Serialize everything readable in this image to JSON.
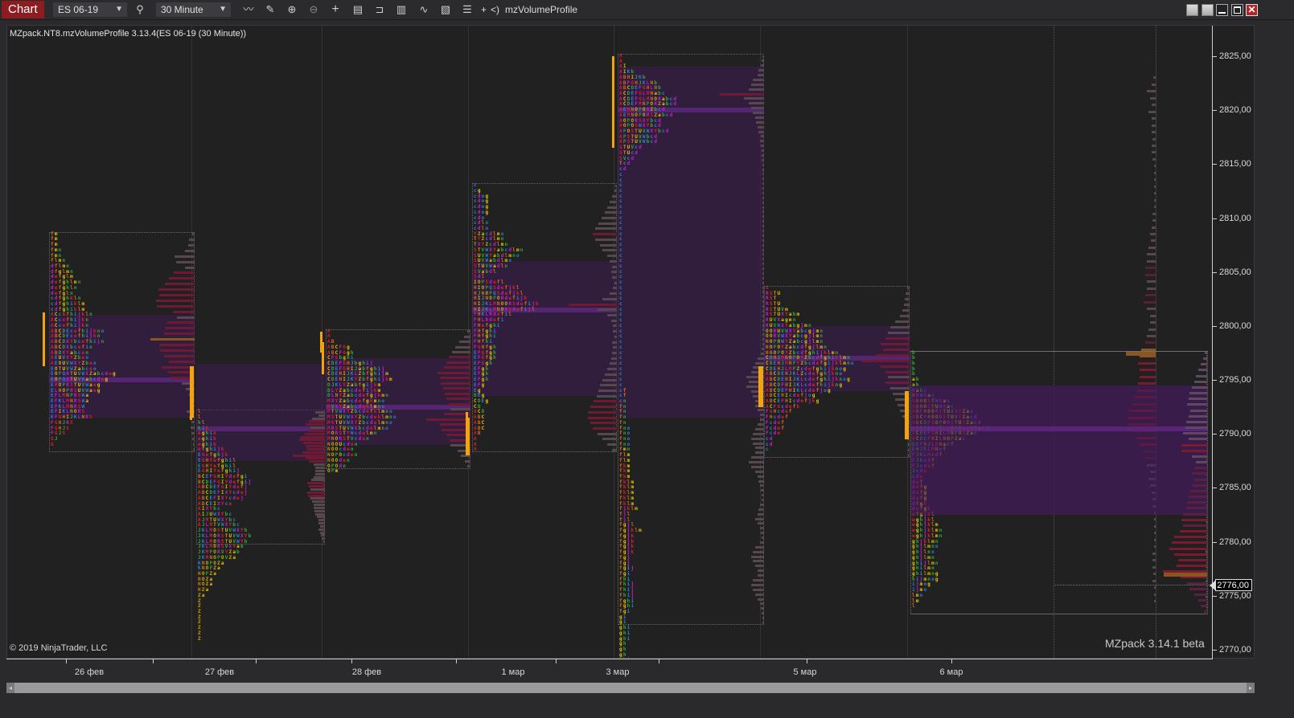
{
  "window": {
    "tab_label": "Chart",
    "instrument": "ES 06-19",
    "timeframe": "30 Minute",
    "indicator_button": "mzVolumeProfile",
    "plus_label": "+",
    "nav_label": "<)",
    "toolbar_icons": [
      "search-icon",
      "line-chart-icon",
      "pencil-icon",
      "zoom-in-icon",
      "zoom-out-icon",
      "crosshair-icon",
      "data-box-icon",
      "bar-spacing-icon",
      "chart-style-icon",
      "indicators-icon",
      "strategies-icon",
      "properties-list-icon"
    ],
    "window_buttons": [
      "restore-icon",
      "tile-icon",
      "minimize-icon",
      "maximize-icon",
      "close-icon"
    ]
  },
  "chart": {
    "indicator_label": "MZpack.NT8.mzVolumeProfile 3.13.4(ES 06-19 (30 Minute))",
    "copyright": "© 2019 NinjaTrader, LLC",
    "watermark": "MZpack 3.14.1 beta",
    "current_price": "2776,00",
    "price_range": [
      2770,
      2825
    ],
    "price_ticks": [
      "2825,00",
      "2820,00",
      "2815,00",
      "2810,00",
      "2805,00",
      "2800,00",
      "2795,00",
      "2790,00",
      "2785,00",
      "2780,00",
      "2775,00",
      "2770,00"
    ],
    "price_tick_values": [
      2825,
      2820,
      2815,
      2810,
      2805,
      2800,
      2795,
      2790,
      2785,
      2780,
      2775,
      2770
    ],
    "date_labels": [
      "26 фев",
      "27 фев",
      "28 фев",
      "1 мар",
      "3 мар",
      "5 мар",
      "6 мар"
    ],
    "colors": {
      "background": "#212121",
      "value_area": "#3b1e4f",
      "poc": "#5e2a7e",
      "volume_high": "#7a1a33",
      "volume_low": "#5a4a50",
      "volume_poc": "#8a5520",
      "initial_balance": "#f5a30c"
    }
  },
  "profiles": [
    {
      "date": "26 фев",
      "high": 2808.5,
      "low": 2788.5,
      "va_high": 2801,
      "va_low": 2791.5,
      "poc": 2795,
      "ib_high": 2801.25,
      "ib_low": 2796.25,
      "ib2_high": 2796.25,
      "ib2_low": 2791.5,
      "vol_poc": 2799,
      "tpo_rows": [
        "fm",
        "fm",
        "fm",
        "fmn",
        "fmn",
        "flmn",
        "dflmn",
        "dfglmn",
        "defglm",
        "defghlmn",
        "defghln",
        "defgln",
        "cdfghkln",
        "cdfghiklm",
        "cdfghiklm",
        "ACcefhijkln",
        "ACcefhijkn",
        "ACcefhijkn",
        "ABCDEcefhijkno",
        "ABCDEcefhijkn",
        "ABCDXYbcefhijn",
        "ABCDXbcefin",
        "ABDXYabcen",
        "AEUVXYZbeo",
        "AEOUVWXYZbeo",
        "EOTUVWZabceo",
        "EOPQRTUVWXZabcdeg",
        "EOPQRTUVWabcdeg",
        "EMOPRSTUVWaeg",
        "ELNOPRSUVWaeg",
        "EFLMNPRSWa",
        "EFKLMNRSWa",
        "EFKLMNRSW",
        "EFIKLNORS",
        "EFGHIJKLNRS",
        "FGHJRS",
        "FGHJS",
        "FGJS",
        "GJ",
        "G"
      ],
      "volume": [
        0.05,
        0.12,
        0.15,
        0.22,
        0.45,
        0.42,
        0.22,
        0.48,
        0.58,
        0.68,
        0.82,
        0.8,
        0.88,
        0.86,
        0.5,
        0.4,
        0.62,
        0.68,
        0.7,
        1.0,
        0.8,
        0.78,
        0.7,
        0.58,
        0.74,
        0.6,
        0.54,
        0.3,
        0.2,
        0.12,
        0.1,
        0.1,
        0.18,
        0.12,
        0.08,
        0.1,
        0.08,
        0.06,
        0.04,
        0.02
      ]
    },
    {
      "date": "27 фев",
      "high": 2792,
      "low": 2780,
      "va_high": 2796.5,
      "va_low": 2787.5,
      "poc": 2790.5,
      "ib_high": 2796.25,
      "ib_low": 2791.25,
      "ib2_high": 2798.5,
      "ib2_low": 2795.5,
      "vol_poc": 2797.5,
      "tpo_rows": [
        "l",
        "l",
        "hl",
        "hik",
        "eghik",
        "eghik",
        "eghik",
        "efghijk",
        "EGefghjk",
        "EGHYefghil",
        "EGHYefghil",
        "EGHIYefghij",
        "BCEFGHIYdefgi",
        "BCDEFGIYdefgij",
        "ABCDEFGIYdefj",
        "ABCDEFIXYcdej",
        "ABCEFIXYcdej",
        "ABCEIXYce",
        "AIXYbc",
        "AIJUWXYbc",
        "AJMTUWXYbc",
        "AJLMTVWXYbc",
        "JKLMOSTUVWXYb",
        "JKLMORSTUVWXYb",
        "JKLMORSTUVWYb",
        "JKLMORSVXYab",
        "JKMPORVYZab",
        "JKMNOPOVZa",
        "KNOPOZa",
        "KNOPZa",
        "NOPZa",
        "NOZa",
        "NOZa",
        "NZa",
        "Za",
        "Z",
        "Z",
        "Z",
        "Z",
        "Z",
        "Z",
        "Z",
        "Z"
      ],
      "volume": [
        0.3,
        0.2,
        0.4,
        0.5,
        0.6,
        0.45,
        0.5,
        0.62,
        0.75,
        0.8,
        0.68,
        0.6,
        0.55,
        0.7,
        1.0,
        0.6,
        0.5,
        0.35,
        0.3,
        0.3,
        0.3,
        0.35,
        0.42,
        0.55,
        0.5,
        0.45,
        0.55,
        0.52,
        0.45,
        0.4,
        0.35,
        0.35,
        0.32,
        0.3,
        0.25,
        0.2,
        0.2,
        0.15,
        0.2,
        0.15,
        0.12,
        0.1,
        0.05
      ]
    },
    {
      "date": "28 фев",
      "high": 2799.5,
      "low": 2787,
      "va_high": 2797,
      "va_low": 2789,
      "poc": 2792.5,
      "ib_high": 2799.5,
      "ib_low": 2797.5,
      "ib2_high": 2791.5,
      "ib2_low": 2788,
      "vol_poc": 2793.5,
      "tpo_rows": [
        "A",
        "A",
        "AB",
        "ABCFGg",
        "ABCFGgh",
        "CFGbghi",
        "CDEFGHJbghij",
        "CDEFGHIJabfghij",
        "CDEHIJKLZbfghijm",
        "CDEHIJKYZbfghijkm",
        "DJKLYZabfgijkm",
        "DLYZabcdefijkm",
        "DLNYZabcdefgjkmn",
        "MXYZabcdefgkmno",
        "MVXYZabcdeklmno",
        "MTVWXYZbcdefklmno",
        "MSTUVWXYZbcdeklmno",
        "MSTUVWXYZbcdelmno",
        "MRSTUVWXbcdelmno",
        "MORSTYWcdelmn",
        "MNORSTVcden",
        "NOOUcden",
        "NOOcden",
        "NOPOcden",
        "NOOden",
        "OPOdn",
        "OPm"
      ],
      "volume": [
        0.08,
        0.15,
        0.25,
        0.35,
        0.42,
        0.5,
        0.55,
        0.6,
        0.75,
        0.7,
        0.68,
        0.62,
        0.58,
        0.55,
        0.5,
        0.45,
        0.6,
        1.0,
        0.7,
        0.65,
        0.55,
        0.48,
        0.45,
        0.3,
        0.22,
        0.12,
        0.08
      ]
    },
    {
      "date": "1 мар",
      "high": 2813,
      "low": 2788.5,
      "va_high": 2806,
      "va_low": 2793.5,
      "poc": 2801.5,
      "ib_high": 2792,
      "ib_low": 2788,
      "vol_poc": 2801.5,
      "tpo_rows": [
        "c",
        "cg",
        "cdog",
        "cdog",
        "cdog",
        "cdog",
        "cdo",
        "cdlo",
        "cdlo",
        "YZacdlmo",
        "TYZcdlmn",
        "TXYZcdlmn",
        "STVWXYabcdlmn",
        "SUVWYabdlmno",
        "SUVWabdlmo",
        "STUVWadln",
        "SVabdl",
        "Sdl",
        "IOPSdefl",
        "HIOPQSdefjkl",
        "HJNOPQSdefjkl",
        "HIJNOPORdefijk",
        "HIJKLMNOORSdefijk",
        "HIJKLMNORSdefijl",
        "FHKLRdefil",
        "FHLRdefi",
        "FHefghi",
        "FHfghi",
        "FHfghi",
        "FHfhi",
        "FGHfgh",
        "EFGfgh",
        "EFGfgh",
        "EFGgh",
        "EFgh",
        "EFgh",
        "EFgh",
        "EFg",
        "Eg",
        "DEg",
        "CDEg",
        "CD",
        "ACD",
        "ABC",
        "ABC",
        "ABC",
        "AB",
        "A",
        "A",
        "A"
      ],
      "volume": [
        0.02,
        0.05,
        0.1,
        0.15,
        0.2,
        0.25,
        0.32,
        0.38,
        0.45,
        0.5,
        0.45,
        0.35,
        0.3,
        0.2,
        0.15,
        0.1,
        0.12,
        0.1,
        0.05,
        0.08,
        0.15,
        0.3,
        1.0,
        0.4,
        0.2,
        0.12,
        0.08,
        0.08,
        0.05,
        0.1,
        0.08,
        0.1,
        0.12,
        0.15,
        0.2,
        0.25,
        0.3,
        0.35,
        0.38,
        0.42,
        0.48,
        0.55,
        0.6,
        0.6,
        0.55,
        0.5,
        0.4,
        0.3,
        0.2,
        0.1
      ]
    },
    {
      "date": "3 мар",
      "high": 2825,
      "low": 2772.5,
      "va_high": 2824,
      "va_low": 2791.5,
      "poc": 2820,
      "ib_high": 2825,
      "ib_low": 2816.5,
      "ib2_high": 2796.25,
      "ib2_low": 2792.5,
      "vol_poc": 2821,
      "tpo_rows": [
        "A",
        "A",
        "AI",
        "AIKb",
        "ABHIJKb",
        "ABFGHJKLNb",
        "ABCDEFGHLNb",
        "ACDEFGLMNabc",
        "ACDEFGLMNORabcd",
        "ACDEFMNPORZabcd",
        "AEMNOPORZbcd",
        "AEMNOPORSZabcd",
        "AOPORSXYbcd",
        "AOPOSWXYbcd",
        "APOSTUVWXYbcd",
        "APSTUVWbcd",
        "APSTUVWbcd",
        "STUVcd",
        "STUcd",
        "SVcd",
        "Tcd",
        "cd",
        "c",
        "c",
        "c",
        "c",
        "c",
        "c",
        "c",
        "c",
        "c",
        "c",
        "c",
        "c",
        "c",
        "c",
        "c",
        "c",
        "c",
        "c",
        "c",
        "c",
        "c",
        "c",
        "c",
        "c",
        "c",
        "c",
        "c",
        "c",
        "c",
        "c",
        "c",
        "c",
        "c",
        "c",
        "c",
        "c",
        "c",
        "c",
        "c",
        "c",
        "cf",
        "cf",
        "cn",
        "fn",
        "fn",
        "fn",
        "fn",
        "fno",
        "fno",
        "fno",
        "fno",
        "fmn",
        "flm",
        "flm",
        "fkm",
        "fkm",
        "fkm",
        "fklm",
        "fklm",
        "fklm",
        "fklm",
        "fklm",
        "fjklm",
        "fjl",
        "fjl",
        "fgjl",
        "fgjklm",
        "fgjk",
        "fgjk",
        "fgjk",
        "fgjk",
        "fgj",
        "fgj",
        "fgij",
        "fgi",
        "fhi",
        "fhij",
        "fhij",
        "fhij",
        "fghi",
        "fghi",
        "fgi",
        "gi",
        "gi",
        "ghi",
        "ghi",
        "ghi",
        "gh",
        "gh",
        "gh",
        "ghi",
        "ghi",
        "ghi",
        "ghi",
        "hi",
        "hi",
        "h"
      ],
      "volume": [
        0.02,
        0.05,
        0.08,
        0.12,
        0.15,
        0.25,
        0.3,
        0.35,
        1.0,
        0.45,
        0.35,
        0.3,
        0.25,
        0.2,
        0.18,
        0.15,
        0.12,
        0.08,
        0.1,
        0.08,
        0.06,
        0.05,
        0.05,
        0.04,
        0.04,
        0.03,
        0.03,
        0.03,
        0.03,
        0.02,
        0.02,
        0.02,
        0.02,
        0.02,
        0.02,
        0.02,
        0.02,
        0.02,
        0.02,
        0.02,
        0.02,
        0.02,
        0.02,
        0.02,
        0.02,
        0.02,
        0.02,
        0.02,
        0.02,
        0.02,
        0.02,
        0.02,
        0.02,
        0.02,
        0.02,
        0.02,
        0.02,
        0.02,
        0.02,
        0.03,
        0.03,
        0.04,
        0.05,
        0.08,
        0.15,
        0.2,
        0.25,
        0.3,
        0.4,
        0.35,
        0.4,
        0.3,
        0.25,
        0.2,
        0.2,
        0.15,
        0.1,
        0.1,
        0.15,
        0.2,
        0.25,
        0.3,
        0.25,
        0.2,
        0.2,
        0.3,
        0.35,
        0.3,
        0.2,
        0.15,
        0.12,
        0.1,
        0.08,
        0.05,
        0.05,
        0.1,
        0.12,
        0.15,
        0.2,
        0.15,
        0.1,
        0.08,
        0.05,
        0.1,
        0.2,
        0.25,
        0.3,
        0.25,
        0.2,
        0.15,
        0.15,
        0.25,
        0.3,
        0.25,
        0.2,
        0.15,
        0.1,
        0.08,
        0.05,
        0.03,
        0.02
      ]
    },
    {
      "date": "5 мар",
      "high": 2803.5,
      "low": 2788,
      "va_high": 2800,
      "va_low": 2794,
      "poc": 2797,
      "ib_high": 2796.25,
      "ib_low": 2792.5,
      "ib2_high": 2794,
      "ib2_low": 2789.5,
      "vol_poc": 2797.5,
      "tpo_rows": [
        "S",
        "RSTU",
        "RST",
        "RSTU",
        "RSTUVm",
        "RSTUXYabm",
        "RUVXagmn",
        "RUVWXYabgjmn",
        "OORUVWXYabcgjmn",
        "OORVWXYabcgjlmn",
        "NOPOWYZabcgjlmn",
        "NOPOYZabcdfgjlmn",
        "HNOPOYZbcdfghijklmn",
        "CDHJMNOPOYZbcdfghiklmn",
        "CDEHJMNPYZbcdefgijklmno",
        "CDEHJLMPZcdefghijknog",
        "ABCDEHJKLZcdefghjkno",
        "ABCDEHIJKLcdefghijknog",
        "ABCDFHIJKLcdefhijkng",
        "ABCDEFHIKLcdefjog",
        "ABCEHIcdefjog",
        "ABCEFHIcdefjkg",
        "ACFGcdefk",
        "FGHcdef",
        "FHcdef",
        "Fcdef",
        "Fcdef",
        "Fcde",
        "cd",
        "cd",
        "c"
      ],
      "volume": [
        0.05,
        0.08,
        0.1,
        0.12,
        0.15,
        0.2,
        0.3,
        0.4,
        0.45,
        0.5,
        0.6,
        0.55,
        0.7,
        1.0,
        0.6,
        0.5,
        0.45,
        0.5,
        0.4,
        0.35,
        0.3,
        0.25,
        0.2,
        0.15,
        0.1,
        0.08,
        0.06,
        0.05,
        0.04,
        0.03,
        0.02
      ]
    },
    {
      "date": "6 мар",
      "high": 2797.5,
      "low": 2773.5,
      "va_high": 2794.5,
      "va_low": 2782.5,
      "poc": 2790.5,
      "ib_high": 2794,
      "ib_low": 2789.5,
      "vol_poc": 2797.5,
      "tpo_rows": [
        "b",
        "b",
        "b",
        "b",
        "b",
        "ab",
        "ab",
        "Rabc",
        "BRWXac",
        "ABHOSTWXac",
        "ABHOSTUWXac",
        "ABFHOORSTUVXYZac",
        "ABCFHOORSTUVYZacd",
        "ABCDFGOPORSTUYZacd",
        "ABCDEFGILMOPORSUZacd",
        "ACDEFGHILMOPOSZac",
        "ACDEFHILNOPZac",
        "DEFHJLMNacf",
        "EHJKLMNcf",
        "FJKLMcdf",
        "FJKcdf",
        "FJcdef",
        "Jcde",
        "cde",
        "def",
        "defg",
        "defg",
        "defg",
        "dfgk",
        "defgk",
        "efgjkl",
        "eghjkl",
        "eghjklm",
        "eghjklmn",
        "eghjklmn",
        "ghjklmn",
        "ghjlmno",
        "ghjlno",
        "ghjlmn",
        "ghijlmn",
        "ghilmn",
        "ghilmng",
        "hijmnog",
        "ijmog",
        "ijmo",
        "lmo",
        "lm",
        "l"
      ],
      "volume": [
        0.9,
        0.75,
        0.6,
        0.5,
        0.4,
        0.35,
        0.3,
        0.25,
        0.2,
        0.18,
        0.16,
        0.15,
        0.14,
        0.13,
        0.12,
        0.1,
        0.08,
        0.05
      ]
    }
  ],
  "developing_profile": {
    "label": "6 мар",
    "high": 2823,
    "low": 2774.5,
    "vol_poc": 2797.5,
    "volume": [
      0.08,
      0.15,
      0.3,
      0.2,
      0.15,
      0.25,
      0.15,
      0.15,
      0.15,
      0.1,
      0.15,
      0.15,
      0.1,
      0.05,
      0.05,
      0.02,
      0.02,
      0.02,
      0.02,
      0.05,
      0.1,
      0.12,
      0.15,
      0.2,
      0.18,
      0.25,
      0.3,
      0.3,
      0.35,
      0.35,
      0.3,
      0.3,
      0.35,
      0.42,
      0.3,
      0.2,
      0.2,
      0.25,
      0.3,
      0.35,
      0.5,
      0.55,
      0.6,
      0.55,
      0.55,
      0.6,
      0.65,
      0.75,
      0.8,
      0.95,
      1.0,
      0.95,
      0.8,
      0.65,
      0.55,
      0.45,
      0.4,
      0.3,
      0.2,
      0.25,
      0.2,
      0.15,
      0.1,
      0.1,
      0.05,
      0.03,
      0.02,
      0.02,
      0.02,
      0.05,
      0.1,
      0.12,
      0.1,
      0.08,
      0.1,
      0.05,
      0.03,
      0.02
    ]
  },
  "last_session_profile": {
    "high": 2797.5,
    "low": 2773.5,
    "va_high": 2794.5,
    "va_low": 2782.5,
    "poc": 2790.5,
    "vol_poc": 2777,
    "volume": [
      0.05,
      0.1,
      0.15,
      0.2,
      0.25,
      0.3,
      0.35,
      0.4,
      0.42,
      0.45,
      0.38,
      0.42,
      0.48,
      0.5,
      0.55,
      0.42,
      0.58,
      0.58,
      0.35,
      0.25,
      0.3,
      0.35,
      0.3,
      0.32,
      0.4,
      0.42,
      0.45,
      0.48,
      0.55,
      0.58,
      0.55,
      0.62,
      0.75,
      0.8,
      0.85,
      0.75,
      0.65,
      0.7,
      1.0,
      0.6,
      0.45,
      0.4,
      0.3,
      0.2,
      0.15,
      0.08
    ]
  }
}
